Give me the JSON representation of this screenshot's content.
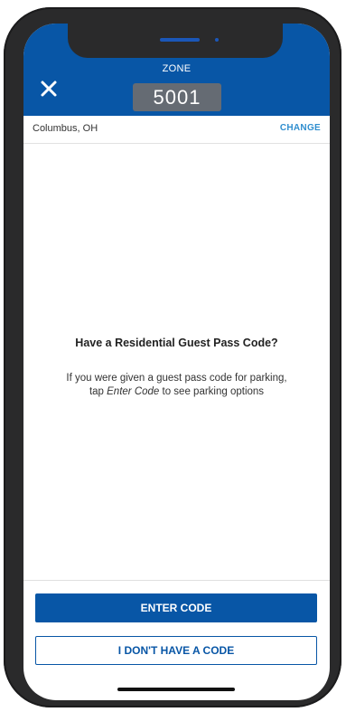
{
  "header": {
    "zone_label": "ZONE",
    "zone_number": "5001",
    "close_icon": "close-icon"
  },
  "location": {
    "name": "Columbus, OH",
    "change_label": "CHANGE"
  },
  "prompt": {
    "title": "Have a Residential Guest Pass Code?",
    "text_before": "If you were given a guest pass code for parking, tap ",
    "text_emphasis": "Enter Code",
    "text_after": " to see parking options"
  },
  "actions": {
    "enter_code_label": "ENTER CODE",
    "no_code_label": "I DON'T HAVE A CODE"
  },
  "colors": {
    "primary": "#0856a6",
    "zone_box": "#656b73",
    "link": "#2f8ecf",
    "device_frame": "#2a2a2b"
  }
}
